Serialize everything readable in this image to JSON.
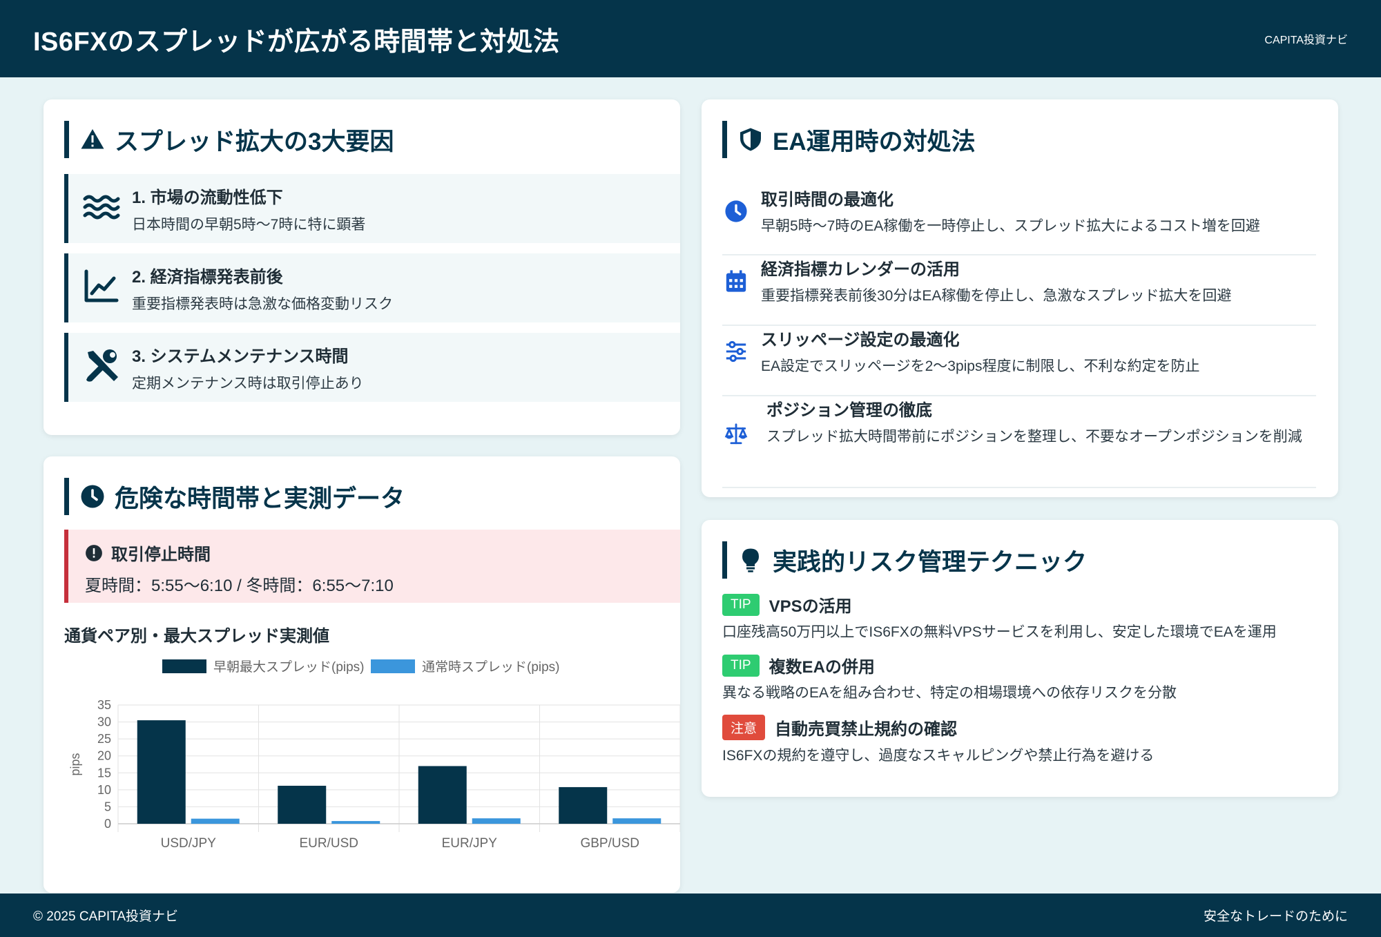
{
  "header": {
    "title": "IS6FXのスプレッドが広がる時間帯と対処法",
    "brand": "CAPITA投資ナビ"
  },
  "causes": {
    "title": "スプレッド拡大の3大要因",
    "items": [
      {
        "title": "1. 市場の流動性低下",
        "desc": "日本時間の早朝5時〜7時に特に顕著",
        "icon": "water-icon"
      },
      {
        "title": "2. 経済指標発表前後",
        "desc": "重要指標発表時は急激な価格変動リスク",
        "icon": "chart-line-icon"
      },
      {
        "title": "3. システムメンテナンス時間",
        "desc": "定期メンテナンス時は取引停止あり",
        "icon": "tools-icon"
      }
    ]
  },
  "danger": {
    "title": "危険な時間帯と実測データ",
    "alert_title": "取引停止時間",
    "alert_desc": "夏時間：5:55〜6:10 / 冬時間：6:55〜7:10",
    "chart_title": "通貨ペア別・最大スプレッド実測値"
  },
  "solutions": {
    "title": "EA運用時の対処法",
    "items": [
      {
        "title": "取引時間の最適化",
        "desc": "早朝5時〜7時のEA稼働を一時停止し、スプレッド拡大によるコスト増を回避",
        "icon": "clock-icon"
      },
      {
        "title": "経済指標カレンダーの活用",
        "desc": "重要指標発表前後30分はEA稼働を停止し、急激なスプレッド拡大を回避",
        "icon": "calendar-icon"
      },
      {
        "title": "スリッページ設定の最適化",
        "desc": "EA設定でスリッページを2〜3pips程度に制限し、不利な約定を防止",
        "icon": "sliders-icon"
      },
      {
        "title": "ポジション管理の徹底",
        "desc": "スプレッド拡大時間帯前にポジションを整理し、不要なオープンポジションを削減",
        "icon": "scale-icon"
      }
    ]
  },
  "tips": {
    "title": "実践的リスク管理テクニック",
    "items": [
      {
        "badge": "TIP",
        "kind": "tip",
        "title": "VPSの活用",
        "desc": "口座残高50万円以上でIS6FXの無料VPSサービスを利用し、安定した環境でEAを運用"
      },
      {
        "badge": "TIP",
        "kind": "tip",
        "title": "複数EAの併用",
        "desc": "異なる戦略のEAを組み合わせ、特定の相場環境への依存リスクを分散"
      },
      {
        "badge": "注意",
        "kind": "warn",
        "title": "自動売買禁止規約の確認",
        "desc": "IS6FXの規約を遵守し、過度なスキャルピングや禁止行為を避ける"
      }
    ]
  },
  "footer": {
    "copyright": "© 2025 CAPITA投資ナビ",
    "tagline": "安全なトレードのために"
  },
  "colors": {
    "navy": "#05344a",
    "blue": "#3b96dc",
    "alert_red": "#c62f3b",
    "tip_green": "#2ecc71",
    "warn_red": "#e04b3c"
  },
  "chart_data": {
    "type": "bar",
    "categories": [
      "USD/JPY",
      "EUR/USD",
      "EUR/JPY",
      "GBP/USD"
    ],
    "series": [
      {
        "name": "早朝最大スプレッド(pips)",
        "values": [
          30.5,
          11.2,
          17.0,
          10.8
        ],
        "color": "#05344a"
      },
      {
        "name": "通常時スプレッド(pips)",
        "values": [
          1.5,
          0.8,
          1.6,
          1.6
        ],
        "color": "#3b96dc"
      }
    ],
    "ylabel": "pips",
    "ylim": [
      0,
      35
    ],
    "yticks": [
      0,
      5,
      10,
      15,
      20,
      25,
      30,
      35
    ],
    "legend": "top",
    "grid": true
  }
}
